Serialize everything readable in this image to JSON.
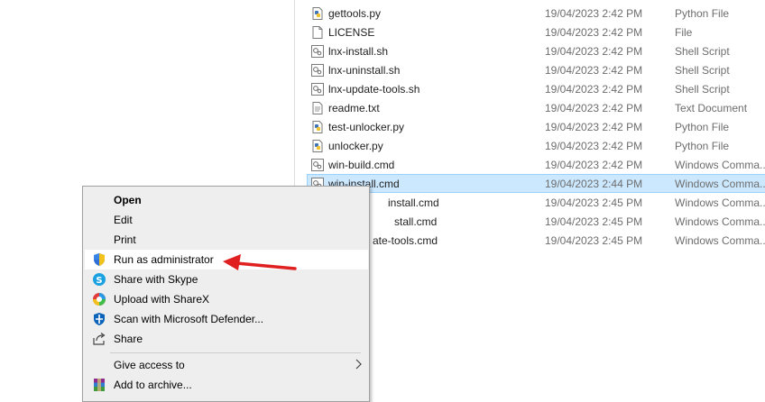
{
  "files": [
    {
      "name": "gettools.py",
      "date": "19/04/2023 2:42 PM",
      "type": "Python File",
      "icon": "python-file-icon"
    },
    {
      "name": "LICENSE",
      "date": "19/04/2023 2:42 PM",
      "type": "File",
      "icon": "blank-file-icon"
    },
    {
      "name": "lnx-install.sh",
      "date": "19/04/2023 2:42 PM",
      "type": "Shell Script",
      "icon": "script-file-icon"
    },
    {
      "name": "lnx-uninstall.sh",
      "date": "19/04/2023 2:42 PM",
      "type": "Shell Script",
      "icon": "script-file-icon"
    },
    {
      "name": "lnx-update-tools.sh",
      "date": "19/04/2023 2:42 PM",
      "type": "Shell Script",
      "icon": "script-file-icon"
    },
    {
      "name": "readme.txt",
      "date": "19/04/2023 2:42 PM",
      "type": "Text Document",
      "icon": "text-file-icon"
    },
    {
      "name": "test-unlocker.py",
      "date": "19/04/2023 2:42 PM",
      "type": "Python File",
      "icon": "python-file-icon"
    },
    {
      "name": "unlocker.py",
      "date": "19/04/2023 2:42 PM",
      "type": "Python File",
      "icon": "python-file-icon"
    },
    {
      "name": "win-build.cmd",
      "date": "19/04/2023 2:42 PM",
      "type": "Windows Comma...",
      "icon": "script-file-icon"
    },
    {
      "name": "win-install.cmd",
      "date": "19/04/2023 2:44 PM",
      "type": "Windows Comma...",
      "icon": "script-file-icon",
      "selected": true
    },
    {
      "name": "install.cmd",
      "date": "19/04/2023 2:45 PM",
      "type": "Windows Comma...",
      "icon": "script-file-icon"
    },
    {
      "name": "stall.cmd",
      "date": "19/04/2023 2:45 PM",
      "type": "Windows Comma...",
      "icon": "script-file-icon"
    },
    {
      "name": "ate-tools.cmd",
      "date": "19/04/2023 2:45 PM",
      "type": "Windows Comma...",
      "icon": "script-file-icon"
    }
  ],
  "context_menu": {
    "items": [
      {
        "label": "Open",
        "bold": true,
        "icon": ""
      },
      {
        "label": "Edit",
        "icon": ""
      },
      {
        "label": "Print",
        "icon": ""
      },
      {
        "label": "Run as administrator",
        "icon": "uac-shield-icon",
        "highlighted": true
      },
      {
        "label": "Share with Skype",
        "icon": "skype-icon"
      },
      {
        "label": "Upload with ShareX",
        "icon": "sharex-icon"
      },
      {
        "label": "Scan with Microsoft Defender...",
        "icon": "defender-icon"
      },
      {
        "label": "Share",
        "icon": "share-icon"
      },
      {
        "label": "Give access to",
        "icon": "",
        "submenu": true
      },
      {
        "label": "Add to archive...",
        "icon": "winrar-icon"
      }
    ]
  },
  "colors": {
    "selection_bg": "#cce8ff",
    "selection_border": "#99d1ff",
    "menu_bg": "#eeeeee",
    "arrow": "#e02020"
  }
}
